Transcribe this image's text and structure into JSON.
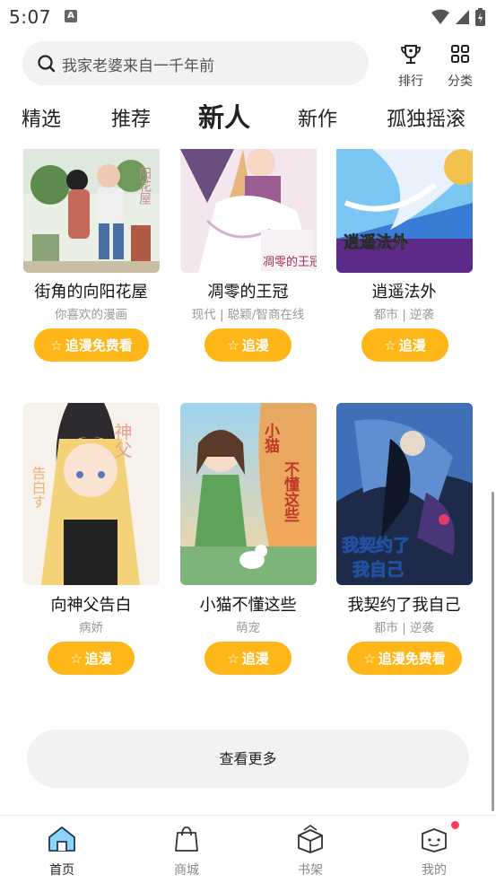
{
  "status_bar": {
    "time": "5:07",
    "notification_letter": "A"
  },
  "search": {
    "placeholder_text": "我家老婆来自一千年前"
  },
  "top_actions": [
    {
      "label": "排行",
      "icon": "trophy-icon"
    },
    {
      "label": "分类",
      "icon": "grid-icon"
    }
  ],
  "tabs": [
    {
      "label": "精选",
      "active": false
    },
    {
      "label": "推荐",
      "active": false
    },
    {
      "label": "新人",
      "active": true
    },
    {
      "label": "新作",
      "active": false
    },
    {
      "label": "孤独摇滚",
      "active": false
    }
  ],
  "comics": [
    {
      "title": "街角的向阳花屋",
      "tags": "你喜欢的漫画",
      "button": "追漫免费看"
    },
    {
      "title": "凋零的王冠",
      "tags": "现代 | 聪颖/智商在线",
      "button": "追漫"
    },
    {
      "title": "逍遥法外",
      "tags": "都市 | 逆袭",
      "button": "追漫"
    },
    {
      "title": "向神父告白",
      "tags": "病娇",
      "button": "追漫"
    },
    {
      "title": "小猫不懂这些",
      "tags": "萌宠",
      "button": "追漫"
    },
    {
      "title": "我契约了我自己",
      "tags": "都市 | 逆袭",
      "button": "追漫免费看"
    }
  ],
  "cover_text": {
    "c1": "阳花屋",
    "c2": "凋零的王冠",
    "c3": "逍遥法外",
    "c4a": "神父",
    "c4b": "告白す",
    "c5a": "小猫",
    "c5b": "不懂这些",
    "c6a": "我契约了",
    "c6b": "我自己"
  },
  "more_button": "查看更多",
  "bottom_nav": [
    {
      "label": "首页",
      "active": true,
      "icon": "home-icon"
    },
    {
      "label": "商城",
      "active": false,
      "icon": "shopping-bag-icon"
    },
    {
      "label": "书架",
      "active": false,
      "icon": "box-icon"
    },
    {
      "label": "我的",
      "active": false,
      "icon": "profile-icon",
      "badge": true
    }
  ],
  "colors": {
    "accent": "#ffb619",
    "badge": "#ff3d5a"
  }
}
